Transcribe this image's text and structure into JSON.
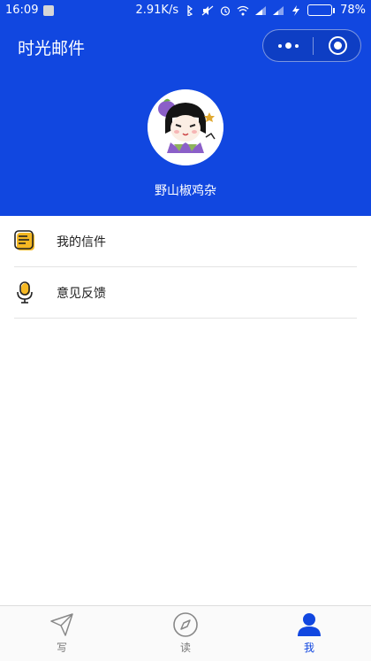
{
  "status_bar": {
    "time": "16:09",
    "network_speed": "2.91K/s",
    "battery_percent": "78%",
    "battery_level": 0.78
  },
  "header": {
    "title": "时光邮件",
    "nickname": "野山椒鸡杂"
  },
  "menu": {
    "items": [
      {
        "label": "我的信件",
        "icon": "letter-icon"
      },
      {
        "label": "意见反馈",
        "icon": "microphone-icon"
      }
    ]
  },
  "tabbar": {
    "tabs": [
      {
        "label": "写",
        "icon": "paper-plane-icon",
        "active": false
      },
      {
        "label": "读",
        "icon": "compass-icon",
        "active": false
      },
      {
        "label": "我",
        "icon": "user-icon",
        "active": true
      }
    ]
  },
  "colors": {
    "brand_blue": "#1147e0",
    "accent_yellow": "#f5b823",
    "battery_green": "#7ee25b"
  }
}
